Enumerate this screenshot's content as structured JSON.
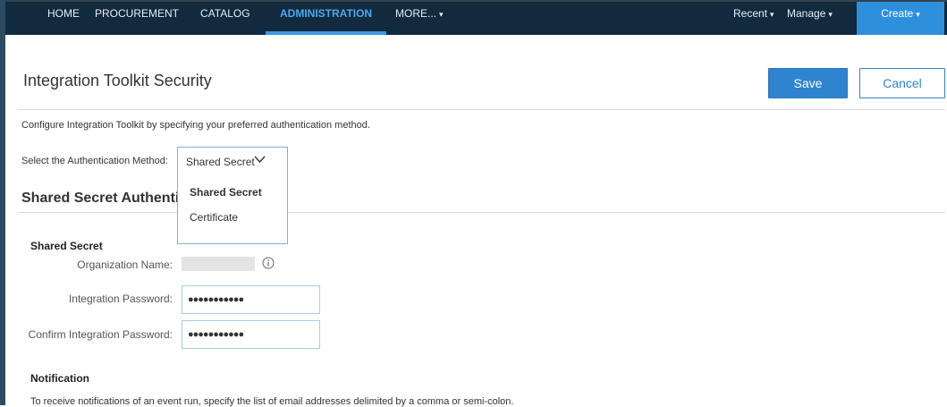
{
  "nav": {
    "home": "HOME",
    "procurement": "PROCUREMENT",
    "catalog": "CATALOG",
    "administration": "ADMINISTRATION",
    "more": "MORE...",
    "recent": "Recent",
    "manage": "Manage",
    "create": "Create",
    "caret": "▾",
    "active_color": "#4ba8f0",
    "background_color": "#112a3e",
    "create_color": "#2e8fdc"
  },
  "page": {
    "title": "Integration Toolkit Security",
    "save_label": "Save",
    "cancel_label": "Cancel",
    "description": "Configure Integration Toolkit by specifying your preferred authentication method."
  },
  "auth": {
    "label": "Select the Authentication Method:",
    "selected": "Shared Secret",
    "options": [
      "Shared Secret",
      "Certificate"
    ],
    "section_heading": "Shared Secret Authenti"
  },
  "shared_secret": {
    "heading": "Shared Secret",
    "org_label": "Organization Name:",
    "password_label": "Integration Password:",
    "password_value": "●●●●●●●●●●●",
    "confirm_label": "Confirm Integration Password:",
    "confirm_value": "●●●●●●●●●●●"
  },
  "notification": {
    "heading": "Notification",
    "text": "To receive notifications of an event run, specify the list of email addresses delimited by a comma or semi-colon."
  },
  "icons": {
    "chevron": "chevron-down-icon",
    "info": "info-icon"
  },
  "colors": {
    "primary": "#2e84cf",
    "select_border": "#7fb3dc"
  }
}
